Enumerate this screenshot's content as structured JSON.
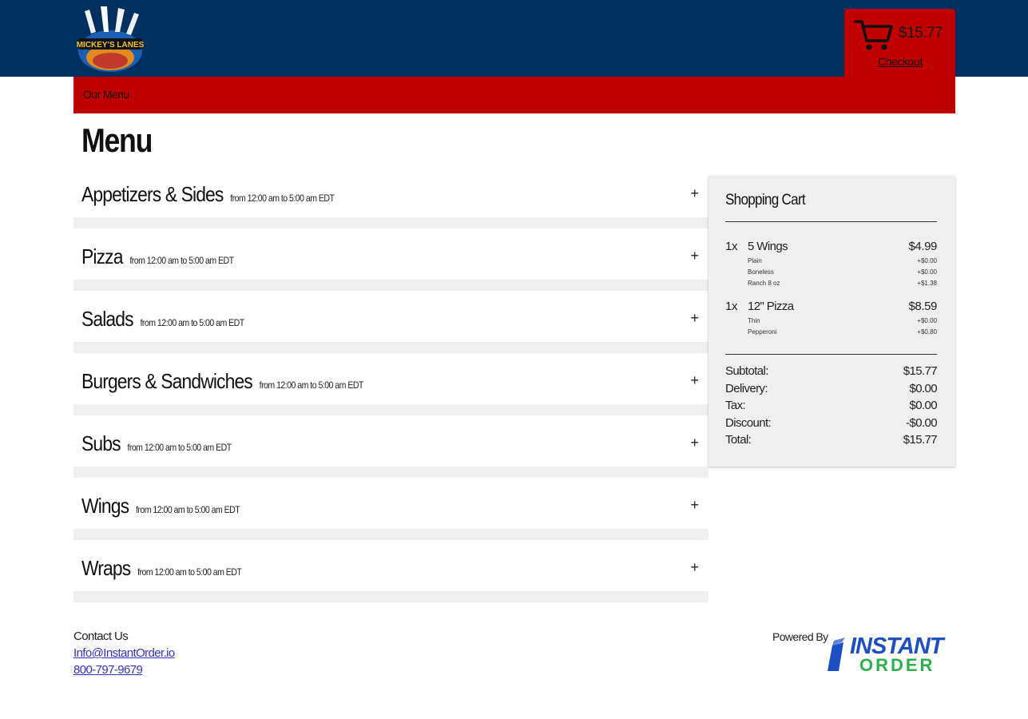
{
  "header": {
    "logo_alt": "MICKEY'S LANES",
    "cart_total": "$15.77",
    "checkout_label": "Checkout"
  },
  "nav": {
    "our_menu_label": "Our Menu"
  },
  "page": {
    "title": "Menu"
  },
  "menu_categories": [
    {
      "name": "Appetizers & Sides",
      "hours": "from 12:00 am to 5:00 am EDT"
    },
    {
      "name": "Pizza",
      "hours": "from 12:00 am to 5:00 am EDT"
    },
    {
      "name": "Salads",
      "hours": "from 12:00 am to 5:00 am EDT"
    },
    {
      "name": "Burgers & Sandwiches",
      "hours": "from 12:00 am to 5:00 am EDT"
    },
    {
      "name": "Subs",
      "hours": "from 12:00 am to 5:00 am EDT"
    },
    {
      "name": "Wings",
      "hours": "from 12:00 am to 5:00 am EDT"
    },
    {
      "name": "Wraps",
      "hours": "from 12:00 am to 5:00 am EDT"
    }
  ],
  "cart": {
    "heading": "Shopping Cart",
    "items": [
      {
        "qty": "1x",
        "name": "5 Wings",
        "price": "$4.99",
        "mods": [
          {
            "name": "Plain",
            "price": "+$0.00"
          },
          {
            "name": "Boneless",
            "price": "+$0.00"
          },
          {
            "name": "Ranch 8 oz",
            "price": "+$1.38"
          }
        ]
      },
      {
        "qty": "1x",
        "name": "12\" Pizza",
        "price": "$8.59",
        "mods": [
          {
            "name": "Thin",
            "price": "+$0.00"
          },
          {
            "name": "Pepperoni",
            "price": "+$0.80"
          }
        ]
      }
    ],
    "totals": [
      {
        "label": "Subtotal:",
        "value": "$15.77"
      },
      {
        "label": "Delivery:",
        "value": "$0.00"
      },
      {
        "label": "Tax:",
        "value": "$0.00"
      },
      {
        "label": "Discount:",
        "value": "-$0.00"
      },
      {
        "label": "Total:",
        "value": "$15.77"
      }
    ]
  },
  "footer": {
    "contact_title": "Contact Us",
    "email": "Info@InstantOrder.io",
    "phone": "800-797-9679",
    "powered_by": "Powered By",
    "brand_line1": "INSTANT",
    "brand_line2": "ORDER"
  },
  "colors": {
    "topbar": "#00305f",
    "accent_red": "#c00000",
    "panel_gray": "#efefef",
    "brand_blue": "#1d4fc4",
    "brand_green": "#2bb04a"
  }
}
